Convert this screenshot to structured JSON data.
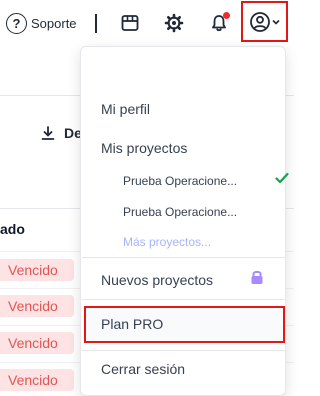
{
  "topbar": {
    "support_label": "Soporte",
    "support_icon": "?",
    "icons": [
      "help-icon",
      "store-icon",
      "gear-icon",
      "bell-icon",
      "user-circle-icon",
      "chevron-down-icon"
    ],
    "notification_dot_color": "#ef2b2b",
    "highlight_color": "#e01818"
  },
  "background": {
    "download_label": "De",
    "column_header": "ado",
    "status_label": "Vencido",
    "status_bg": "#fde3e3",
    "status_color": "#e25555"
  },
  "dropdown": {
    "mi_perfil": "Mi perfil",
    "mis_proyectos": "Mis proyectos",
    "projects": [
      {
        "name": "Prueba Operacione...",
        "selected": true
      },
      {
        "name": "Prueba Operacione...",
        "selected": false
      }
    ],
    "more_projects": "Más proyectos...",
    "nuevos_proyectos": "Nuevos proyectos",
    "plan_pro": "Plan PRO",
    "cerrar_sesion": "Cerrar sesión",
    "check_color": "#16a34a",
    "lock_color": "#a78bfa",
    "more_color": "#a5b4fc"
  }
}
